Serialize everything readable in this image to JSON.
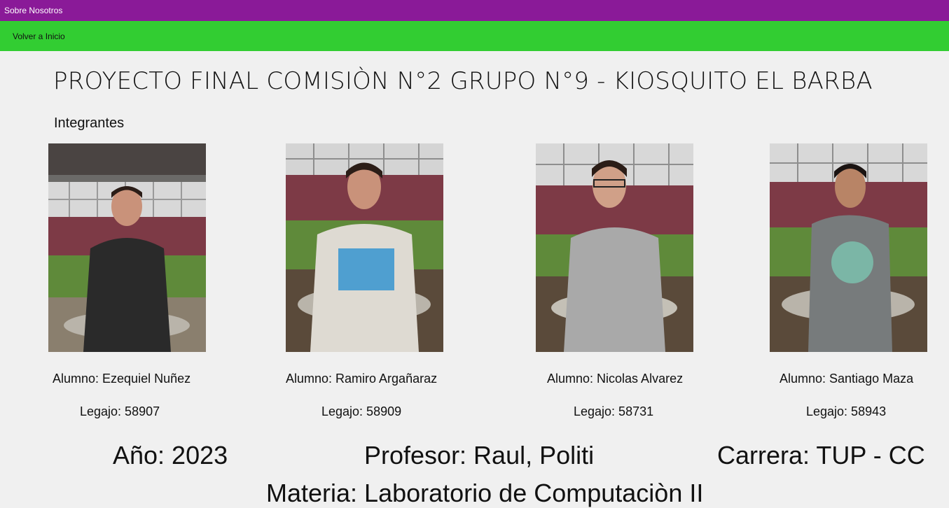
{
  "window": {
    "title": "Sobre Nosotros"
  },
  "nav": {
    "back_label": "Volver a Inicio"
  },
  "page": {
    "title": "PROYECTO FINAL COMISIÒN N°2 GRUPO N°9 - KIOSQUITO EL BARBA",
    "members_label": "Integrantes"
  },
  "members": [
    {
      "name": "Alumno: Ezequiel Nuñez",
      "legajo": "Legajo: 58907",
      "shirt": "#2a2a2a"
    },
    {
      "name": "Alumno: Ramiro Argañaraz",
      "legajo": "Legajo: 58909",
      "shirt": "#dedad2"
    },
    {
      "name": "Alumno: Nicolas Alvarez",
      "legajo": "Legajo: 58731",
      "shirt": "#a9a9a9"
    },
    {
      "name": "Alumno: Santiago Maza",
      "legajo": "Legajo: 58943",
      "shirt": "#777b7c"
    }
  ],
  "footer": {
    "year": "Año: 2023",
    "professor": "Profesor: Raul, Politi",
    "career": "Carrera: TUP - CC",
    "subject": "Materia: Laboratorio de Computaciòn II"
  },
  "colors": {
    "titlebar": "#8a1a98",
    "navbar": "#32cd32",
    "background": "#f0f0f0",
    "banner": "#7d3a46"
  }
}
